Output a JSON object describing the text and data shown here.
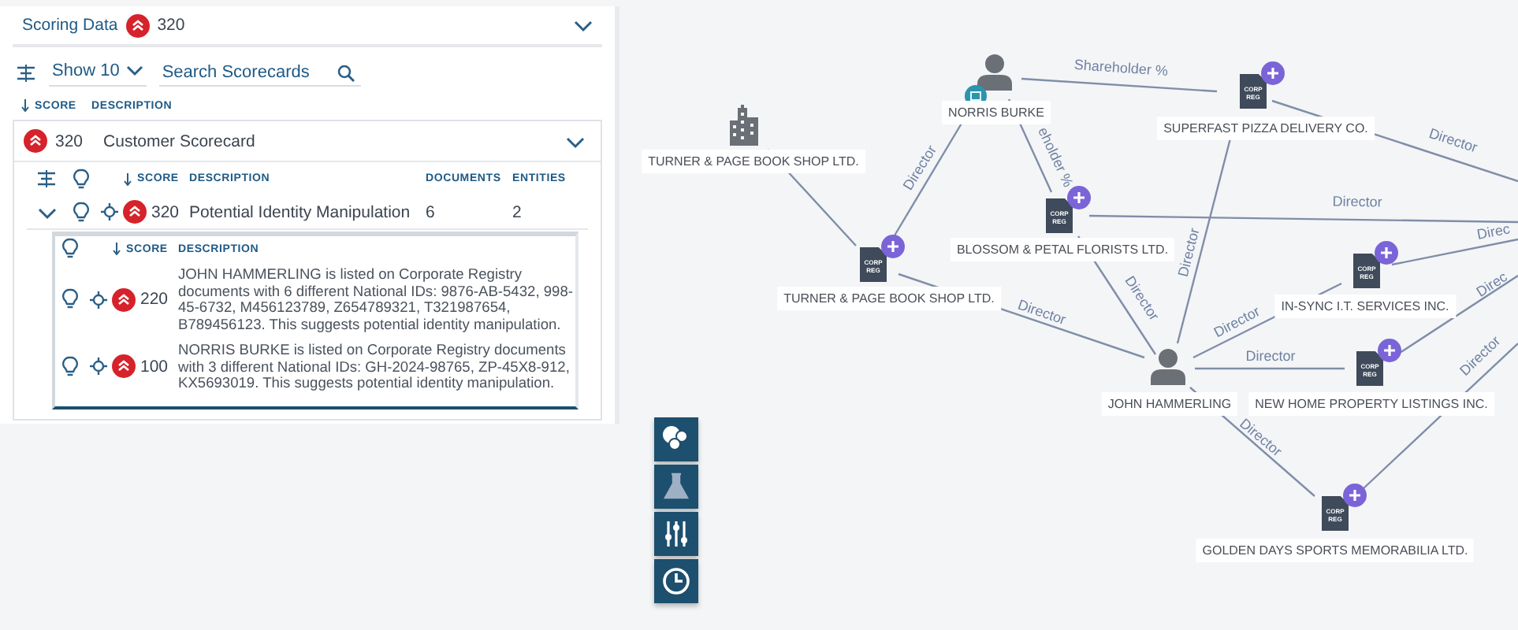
{
  "scoring_data": {
    "title": "Scoring Data",
    "score": "320",
    "expanded": true
  },
  "toolbar": {
    "page_size": "Show 10",
    "search": {
      "placeholder": "Search Scorecards"
    }
  },
  "columns": [
    {
      "label": "SCORE",
      "sorted": true
    },
    {
      "label": "DESCRIPTION",
      "sorted": false
    }
  ],
  "scorecards": [
    {
      "score": "320",
      "description": "Customer Scorecard",
      "expanded": true,
      "columns": [
        {
          "label": "SCORE",
          "sorted": true
        },
        {
          "label": "DESCRIPTION",
          "sorted": false
        },
        {
          "label": "DOCUMENTS",
          "sorted": false
        },
        {
          "label": "ENTITIES",
          "sorted": false
        }
      ],
      "rules": [
        {
          "score": "320",
          "description": "Potential Identity Manipulation",
          "documents": "6",
          "entities": "2",
          "expanded": true,
          "columns": [
            {
              "label": "SCORE",
              "sorted": true
            },
            {
              "label": "DESCRIPTION",
              "sorted": false
            }
          ],
          "findings": [
            {
              "score": "220",
              "description": "JOHN HAMMERLING is listed on Corporate Registry documents with 6 different National IDs: 9876-AB-5432, 998-45-6732, M456123789, Z654789321, T321987654, B789456123. This suggests potential identity manipulation."
            },
            {
              "score": "100",
              "description": "NORRIS BURKE is listed on Corporate Registry documents with 3 different National IDs: GH-2024-98765, ZP-45X8-912, KX5693019. This suggests potential identity manipulation."
            }
          ]
        }
      ]
    }
  ],
  "graph": {
    "nodes": [
      {
        "kind": "organization",
        "label": "TURNER & PAGE BOOK SHOP LTD."
      },
      {
        "kind": "person",
        "label": "NORRIS BURKE",
        "annotated": true
      },
      {
        "kind": "document",
        "label": "SUPERFAST PIZZA DELIVERY CO.",
        "doc_text": "CORP REG",
        "addable": true
      },
      {
        "kind": "document",
        "label": "BLOSSOM & PETAL FLORISTS LTD.",
        "doc_text": "CORP REG",
        "addable": true
      },
      {
        "kind": "document",
        "label": "TURNER & PAGE BOOK SHOP LTD.",
        "doc_text": "CORP REG",
        "addable": true
      },
      {
        "kind": "document",
        "label": "IN-SYNC I.T. SERVICES INC.",
        "doc_text": "CORP REG",
        "addable": true
      },
      {
        "kind": "person",
        "label": "JOHN HAMMERLING",
        "annotated": false
      },
      {
        "kind": "document",
        "label": "NEW HOME PROPERTY LISTINGS INC.",
        "doc_text": "CORP REG",
        "addable": true
      },
      {
        "kind": "document",
        "label": "GOLDEN DAYS SPORTS MEMORABILIA LTD.",
        "doc_text": "CORP REG",
        "addable": true
      }
    ],
    "edges": [
      {
        "label": "Shareholder %"
      },
      {
        "label": "eholder %"
      },
      {
        "label": "Director"
      },
      {
        "label": "Director"
      },
      {
        "label": "Director"
      },
      {
        "label": "Director"
      },
      {
        "label": "Director"
      },
      {
        "label": "Director"
      },
      {
        "label": "Direc"
      },
      {
        "label": "Direc"
      },
      {
        "label": "Director"
      },
      {
        "label": "Director"
      },
      {
        "label": "Director"
      },
      {
        "label": "Director"
      }
    ]
  },
  "graph_tools": [
    {
      "kind": "circles"
    },
    {
      "kind": "flask"
    },
    {
      "kind": "sliders"
    },
    {
      "kind": "clock"
    }
  ]
}
